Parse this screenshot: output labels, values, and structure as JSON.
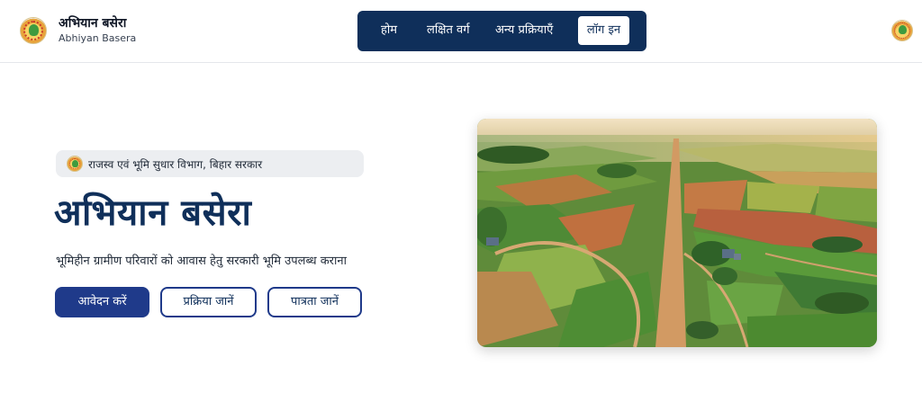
{
  "header": {
    "title": "अभियान बसेरा",
    "subtitle": "Abhiyan Basera",
    "logo_icon": "state-emblem-icon"
  },
  "nav": {
    "items": [
      {
        "label": "होम"
      },
      {
        "label": "लक्षित वर्ग"
      },
      {
        "label": "अन्य प्रक्रियाएँ"
      }
    ],
    "login_label": "लॉग इन",
    "background": "#0f2f5a"
  },
  "hero": {
    "badge_text": "राजस्व एवं भूमि सुधार विभाग, बिहार सरकार",
    "title": "अभियान बसेरा",
    "subtitle": "भूमिहीन ग्रामीण परिवारों को आवास हेतु सरकारी भूमि उपलब्ध कराना",
    "buttons": {
      "apply": "आवेदन करें",
      "process": "प्रक्रिया जानें",
      "eligibility": "पात्रता जानें"
    },
    "image_icon": "aerial-farmland-image"
  },
  "colors": {
    "primary": "#0f2f5a",
    "button_primary": "#1f3a8a"
  }
}
